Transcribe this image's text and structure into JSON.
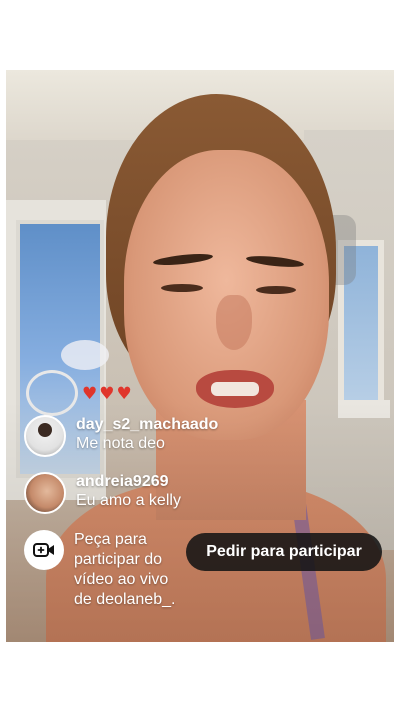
{
  "live": {
    "reactions": "♥♥♥",
    "comments": [
      {
        "username": "day_s2_machaado",
        "message": "Me nota deo",
        "avatar_icon": "user-avatar-icon"
      },
      {
        "username": "andreia9269",
        "message": "Eu amo a kelly",
        "avatar_icon": "user-avatar-icon"
      }
    ],
    "join_prompt": "Peça para participar do vídeo ao vivo de deolaneb_.",
    "join_button": "Pedir para participar",
    "camera_icon": "video-camera-plus-icon"
  },
  "colors": {
    "heart": "#e0352b",
    "button_bg": "#141414",
    "text": "#ffffff"
  }
}
